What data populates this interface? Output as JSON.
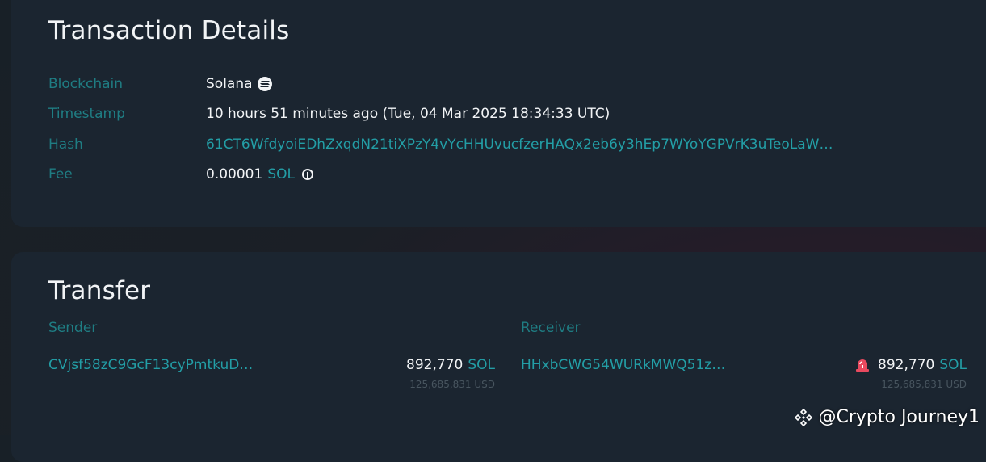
{
  "details": {
    "title": "Transaction Details",
    "blockchain": {
      "label": "Blockchain",
      "value": "Solana"
    },
    "timestamp": {
      "label": "Timestamp",
      "value": "10 hours 51 minutes ago (Tue, 04 Mar 2025 18:34:33 UTC)"
    },
    "hash": {
      "label": "Hash",
      "value": "61CT6WfdyoiEDhZxqdN21tiXPzY4vYcHHUvucfzerHAQx2eb6y3hEp7WYoYGPVrK3uTeoLaW…"
    },
    "fee": {
      "label": "Fee",
      "value": "0.00001",
      "unit": "SOL"
    }
  },
  "transfer": {
    "title": "Transfer",
    "sender": {
      "heading": "Sender",
      "address": "CVjsf58zC9GcF13cyPmtkuD…",
      "amount": "892,770",
      "unit": "SOL",
      "usd": "125,685,831 USD"
    },
    "receiver": {
      "heading": "Receiver",
      "address": "HHxbCWG54WURkMWQ51z…",
      "amount": "892,770",
      "unit": "SOL",
      "usd": "125,685,831 USD"
    }
  },
  "watermark": {
    "text": "@Crypto Journey1"
  },
  "colors": {
    "accent": "#239ea6",
    "label": "#1f7d83",
    "card": "#1b2530",
    "alarm": "#e84a5f"
  }
}
